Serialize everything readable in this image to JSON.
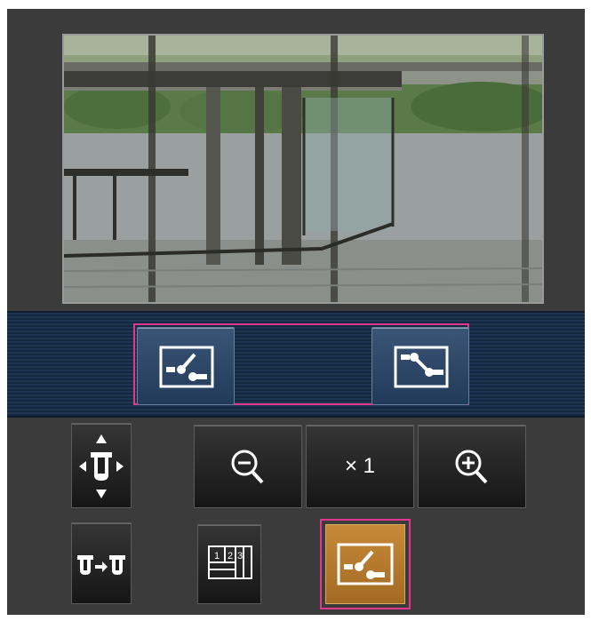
{
  "camera": {
    "scene_description_icon": "live-camera-image"
  },
  "mode_buttons": [
    {
      "name": "normal-shot",
      "icon": "tilt-up-icon"
    },
    {
      "name": "tilt-down",
      "icon": "tilt-down-icon"
    }
  ],
  "controls": {
    "zoom_level": "× 1",
    "zoom_out_icon": "zoom-out-icon",
    "zoom_in_icon": "zoom-in-icon",
    "pan_tilt_icon": "pan-tilt-icon",
    "camera_switch_icon": "camera-switch-icon",
    "multi_screen_icon": "multi-screen-icon",
    "multi_screen_digits": [
      "1",
      "2",
      "3"
    ],
    "selected_mode_icon": "tilt-up-icon"
  },
  "colors": {
    "frame_bg": "#3b3b3b",
    "highlight": "#e0388e",
    "blue_button": "#2d4668",
    "orange_button": "#b57a2e"
  }
}
